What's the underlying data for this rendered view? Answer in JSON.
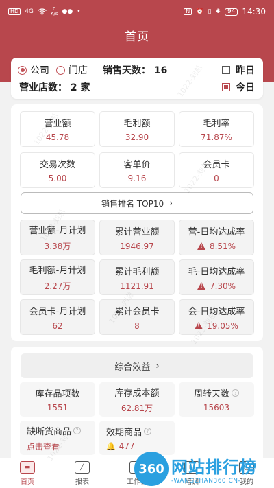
{
  "status_bar": {
    "left_icons": [
      "HD",
      "4G",
      "wifi-icon"
    ],
    "speed_value": "0",
    "speed_unit": "K/s",
    "right_icons": [
      "nfc-icon",
      "alarm-icon",
      "vibrate-icon",
      "bluetooth-icon"
    ],
    "battery": "94",
    "time": "14:30"
  },
  "header": {
    "title": "首页"
  },
  "filters": {
    "radio_company": "公司",
    "radio_store": "门店",
    "selected": "公司",
    "sales_days_label": "销售天数：",
    "sales_days_value": "16",
    "store_count_label": "营业店数：",
    "store_count_value": "2 家",
    "yesterday": "昨日",
    "today": "今日",
    "yesterday_checked": false,
    "today_checked": true
  },
  "summary_stats": [
    {
      "label": "营业额",
      "value": "45.78"
    },
    {
      "label": "毛利额",
      "value": "32.90"
    },
    {
      "label": "毛利率",
      "value": "71.87%"
    },
    {
      "label": "交易次数",
      "value": "5.00"
    },
    {
      "label": "客单价",
      "value": "9.16"
    },
    {
      "label": "会员卡",
      "value": "0"
    }
  ],
  "rank_button": {
    "label": "销售排名 TOP10",
    "chevron": "›"
  },
  "plan_stats": [
    {
      "label": "营业额-月计划",
      "value": "3.38万",
      "warn": false
    },
    {
      "label": "累计营业额",
      "value": "1946.97",
      "warn": false
    },
    {
      "label": "营-日均达成率",
      "value": "8.51%",
      "warn": true
    },
    {
      "label": "毛利额-月计划",
      "value": "2.27万",
      "warn": false
    },
    {
      "label": "累计毛利额",
      "value": "1121.91",
      "warn": false
    },
    {
      "label": "毛-日均达成率",
      "value": "7.30%",
      "warn": true
    },
    {
      "label": "会员卡-月计划",
      "value": "62",
      "warn": false
    },
    {
      "label": "累计会员卡",
      "value": "8",
      "warn": false
    },
    {
      "label": "会-日均达成率",
      "value": "19.05%",
      "warn": true
    }
  ],
  "benefit_button": {
    "label": "综合效益",
    "chevron": "›"
  },
  "inventory": [
    {
      "label": "库存品项数",
      "value": "1551"
    },
    {
      "label": "库存成本额",
      "value": "62.81万"
    },
    {
      "label": "周转天数",
      "value": "15603",
      "help": "?"
    },
    {
      "label": "缺断货商品",
      "value": "点击查看",
      "help": "?"
    },
    {
      "label": "效期商品",
      "value": "477",
      "help": "?"
    }
  ],
  "bottom_nav": [
    {
      "label": "首页",
      "icon": "home-icon",
      "active": true
    },
    {
      "label": "报表",
      "icon": "chart-icon",
      "active": false
    },
    {
      "label": "工作台",
      "icon": "workbench-icon",
      "active": false
    },
    {
      "label": "培训",
      "icon": "training-icon",
      "active": false
    },
    {
      "label": "我的",
      "icon": "profile-icon",
      "active": false
    }
  ],
  "watermark": {
    "text": "1022-刘总"
  },
  "overlay_logo": {
    "badge": "360",
    "cn": "网站排行榜",
    "en": "-WANGZHAN360.CN-"
  },
  "colors": {
    "primary": "#b8474d",
    "background": "#f2f2f2",
    "accent_logo": "#2aa0e0"
  }
}
